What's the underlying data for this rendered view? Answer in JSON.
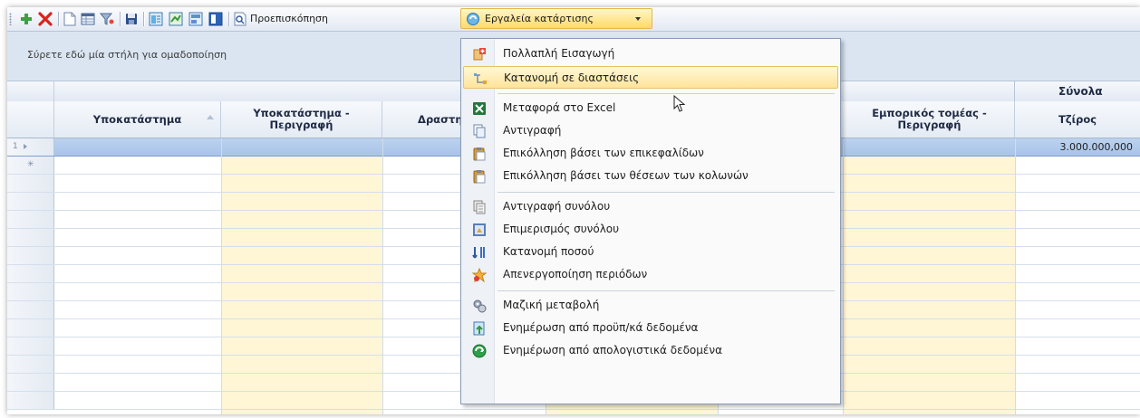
{
  "toolbar": {
    "preview_label": "Προεπισκόπηση",
    "tools_label": "Εργαλεία κατάρτισης"
  },
  "group_panel": {
    "text": "Σύρετε εδώ μία στήλη για ομαδοποίηση"
  },
  "grid": {
    "band_label": "Σύνολα",
    "columns": [
      "Υποκατάστημα",
      "Υποκατάστημα - Περιγραφή",
      "Δραστηριότητα",
      "Εμπορικός τομέας - Περιγραφή",
      "Τζίρος"
    ],
    "rows": [
      {
        "indicator": "1",
        "total": "3.000.000,000",
        "selected": true
      }
    ]
  },
  "menu": {
    "items": [
      {
        "label": "Πολλαπλή Εισαγωγή",
        "icon": "multi-insert-icon"
      },
      {
        "label": "Κατανομή σε διαστάσεις",
        "icon": "dimensions-icon"
      },
      {
        "label": "Μεταφορά στο Excel",
        "icon": "excel-icon"
      },
      {
        "label": "Αντιγραφή",
        "icon": "copy-icon"
      },
      {
        "label": "Επικόλληση βάσει των επικεφαλίδων",
        "icon": "paste-icon"
      },
      {
        "label": "Επικόλληση βάσει των θέσεων των κολωνών",
        "icon": "paste-icon"
      },
      {
        "label": "Αντιγραφή συνόλου",
        "icon": "copy-total-icon"
      },
      {
        "label": "Επιμερισμός συνόλου",
        "icon": "apportion-icon"
      },
      {
        "label": "Κατανομή ποσού",
        "icon": "allocate-amount-icon"
      },
      {
        "label": "Απενεργοποίηση περιόδων",
        "icon": "disable-periods-icon"
      },
      {
        "label": "Μαζική μεταβολή",
        "icon": "bulk-change-icon"
      },
      {
        "label": "Ενημέρωση από προϋπ/κά δεδομένα",
        "icon": "update-budget-icon"
      },
      {
        "label": "Ενημέρωση από απολογιστικά δεδομένα",
        "icon": "update-actual-icon"
      }
    ]
  }
}
